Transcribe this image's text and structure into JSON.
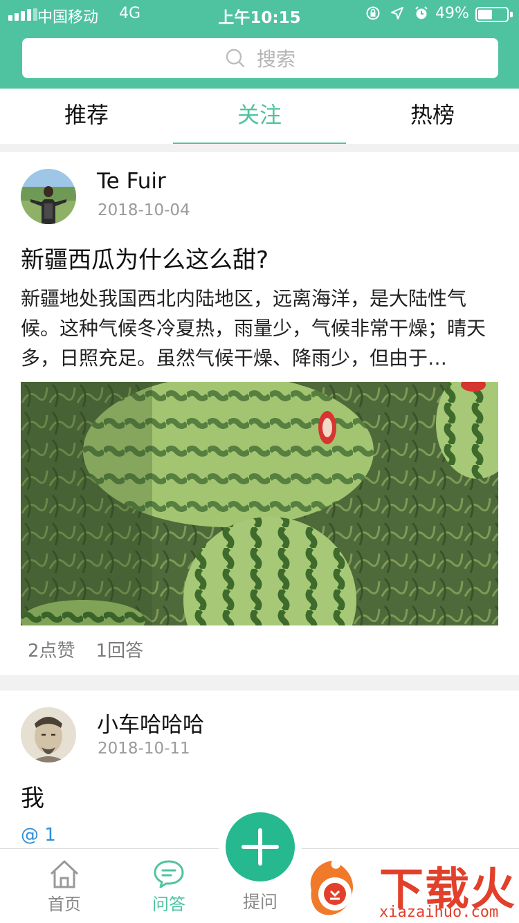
{
  "status_bar": {
    "carrier": "中国移动",
    "network": "4G",
    "time": "上午10:15",
    "battery": "49%",
    "battery_level": 0.49
  },
  "search": {
    "placeholder": "搜索"
  },
  "tabs": [
    {
      "label": "推荐",
      "active": false
    },
    {
      "label": "关注",
      "active": true
    },
    {
      "label": "热榜",
      "active": false
    }
  ],
  "posts": [
    {
      "author": "Te Fuir",
      "date": "2018-10-04",
      "title": "新疆西瓜为什么这么甜?",
      "body": "新疆地处我国西北内陆地区，远离海洋，是大陆性气候。这种气候冬冷夏热，雨量少，气候非常干燥；晴天多，日照充足。虽然气候干燥、降雨少，但由于…",
      "likes": "2点赞",
      "answers": "1回答"
    },
    {
      "author": "小车哈哈哈",
      "date": "2018-10-11",
      "title": "我",
      "mention": "@ 1"
    }
  ],
  "bottom_nav": {
    "home": "首页",
    "qa": "问答",
    "ask": "提问"
  },
  "watermark": {
    "text": "下载火",
    "url": "xiazaihuo.com"
  },
  "colors": {
    "accent": "#4fc3a0",
    "fab": "#26b98f",
    "link": "#2f8fd8"
  }
}
